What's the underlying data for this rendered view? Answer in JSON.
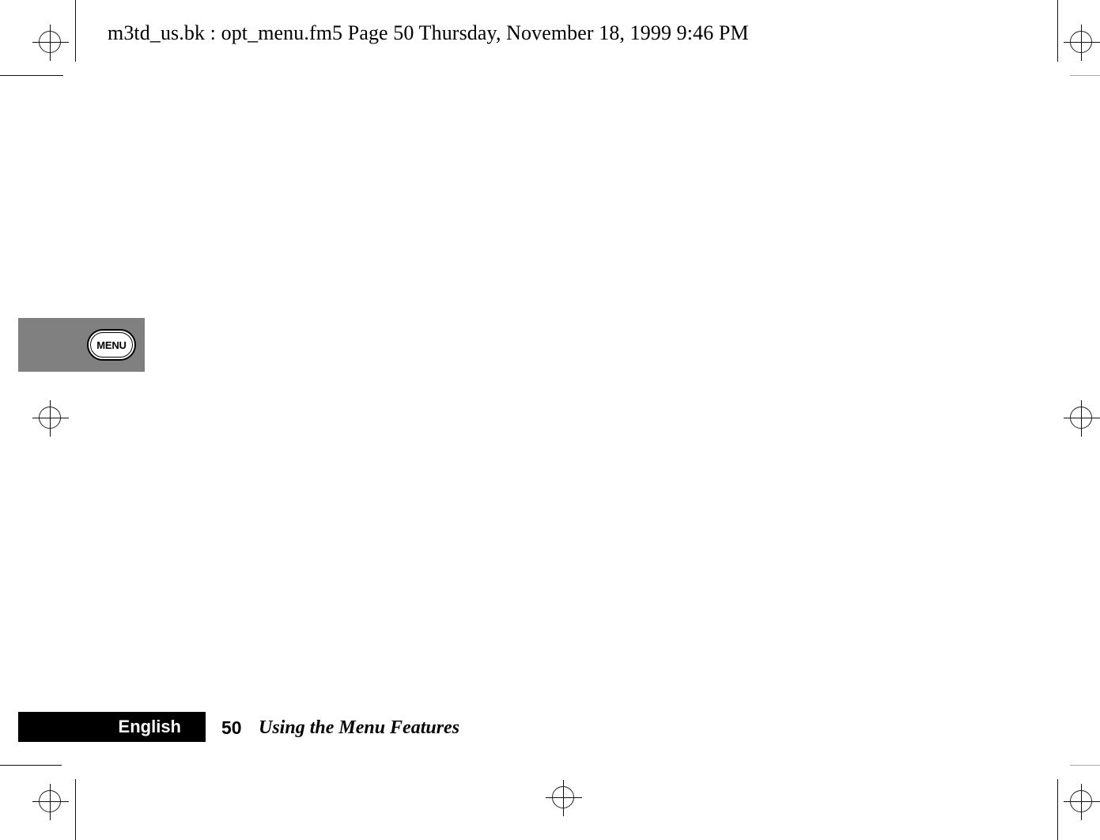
{
  "document": {
    "header_stamp": "m3td_us.bk : opt_menu.fm5  Page 50  Thursday, November 18, 1999  9:46 PM",
    "page_background": "#ffffff"
  },
  "figure": {
    "name": "menu-key-figure",
    "background_color": "#808080",
    "key_label": "MENU",
    "key_fill": "#ffffff",
    "key_border": "#000000"
  },
  "footer": {
    "language": "English",
    "language_bar_color": "#000000",
    "language_text_color": "#ffffff",
    "page_number": "50",
    "section_title": "Using the Menu Features"
  },
  "printer_marks": {
    "registration_icon": "registration-target-icon",
    "trim_line_color": "#111111",
    "trim_line_color_light": "#a8a8a8"
  }
}
